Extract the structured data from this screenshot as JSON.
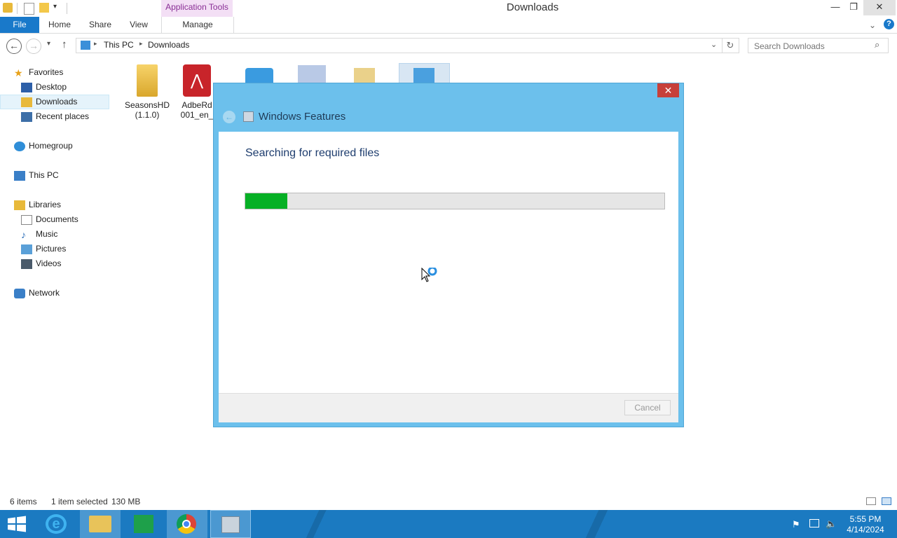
{
  "window": {
    "title": "Downloads",
    "contextual_tab_group": "Application Tools",
    "minimize_icon": "minimize-icon",
    "restore_icon": "restore-icon",
    "close_icon": "close-icon"
  },
  "ribbon": {
    "file_tab": "File",
    "tabs": [
      "Home",
      "Share",
      "View",
      "Manage"
    ]
  },
  "address": {
    "path": [
      "This PC",
      "Downloads"
    ],
    "search_placeholder": "Search Downloads"
  },
  "nav": {
    "favorites": "Favorites",
    "desktop": "Desktop",
    "downloads": "Downloads",
    "recent": "Recent places",
    "homegroup": "Homegroup",
    "thispc": "This PC",
    "libraries": "Libraries",
    "documents": "Documents",
    "music": "Music",
    "pictures": "Pictures",
    "videos": "Videos",
    "network": "Network"
  },
  "files": [
    {
      "name": "SeasonsHD (1.1.0)",
      "icon": "folder-icon"
    },
    {
      "name": "AdbeRd 001_en_",
      "icon": "adobe-installer-icon"
    }
  ],
  "dialog": {
    "title": "Windows Features",
    "heading": "Searching for required files",
    "progress_fraction": 0.1,
    "cancel_label": "Cancel"
  },
  "status": {
    "items": "6 items",
    "selection": "1 item selected",
    "size": "130 MB"
  },
  "taskbar": {
    "time": "5:55 PM",
    "date": "4/14/2024"
  },
  "colors": {
    "accent": "#1979ca",
    "dialog_frame": "#6cc0ec",
    "progress": "#06b025",
    "taskbar": "#1b7ac1",
    "close_red": "#c7403a"
  }
}
